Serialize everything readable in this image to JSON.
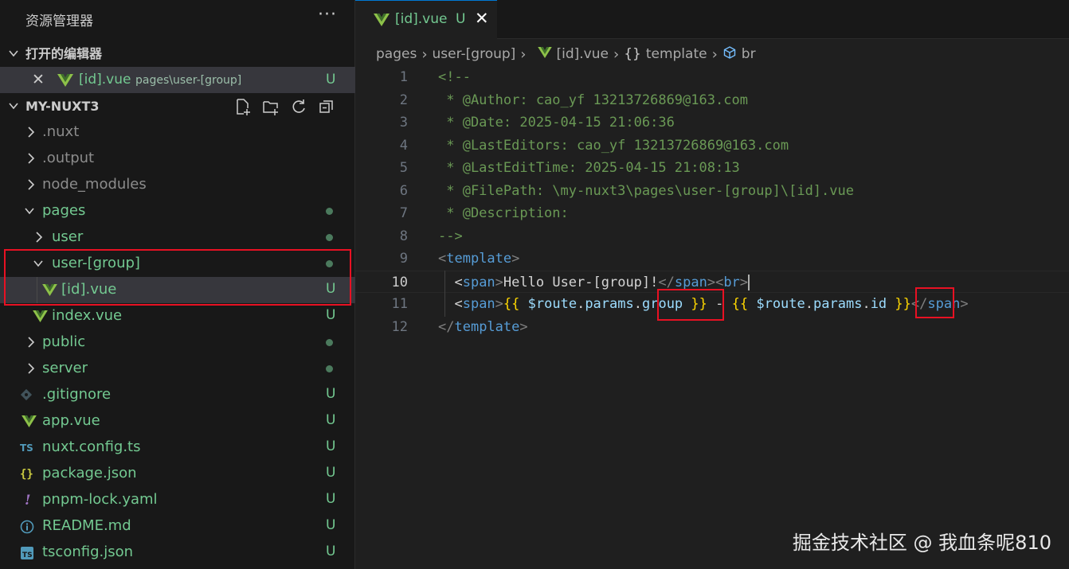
{
  "sidebar": {
    "title": "资源管理器",
    "more_icon": "···",
    "open_editors": {
      "label": "打开的编辑器",
      "item": {
        "close": "✕",
        "file": "[id].vue",
        "path": "pages\\user-[group]",
        "status": "U"
      }
    },
    "project": {
      "label": "MY-NUXT3"
    },
    "tree": [
      {
        "name": ".nuxt",
        "status": ""
      },
      {
        "name": ".output",
        "status": ""
      },
      {
        "name": "node_modules",
        "status": ""
      },
      {
        "name": "pages",
        "status": ""
      },
      {
        "name": "user",
        "status": ""
      },
      {
        "name": "user-[group]",
        "status": ""
      },
      {
        "name": "[id].vue",
        "status": "U"
      },
      {
        "name": "index.vue",
        "status": "U"
      },
      {
        "name": "public",
        "status": ""
      },
      {
        "name": "server",
        "status": ""
      },
      {
        "name": ".gitignore",
        "status": "U"
      },
      {
        "name": "app.vue",
        "status": "U"
      },
      {
        "name": "nuxt.config.ts",
        "status": "U"
      },
      {
        "name": "package.json",
        "status": "U"
      },
      {
        "name": "pnpm-lock.yaml",
        "status": "U"
      },
      {
        "name": "README.md",
        "status": "U"
      },
      {
        "name": "tsconfig.json",
        "status": "U"
      }
    ]
  },
  "editor": {
    "tab": {
      "name": "[id].vue",
      "status": "U",
      "close": "✕"
    },
    "breadcrumb": [
      "pages",
      "user-[group]",
      "[id].vue",
      "template",
      "br"
    ],
    "breadcrumb_braces": "{}",
    "lines": [
      {
        "n": "1",
        "t": [
          "<!--"
        ]
      },
      {
        "n": "2",
        "t": [
          " * @Author: cao_yf 13213726869@163.com"
        ]
      },
      {
        "n": "3",
        "t": [
          " * @Date: 2025-04-15 21:06:36"
        ]
      },
      {
        "n": "4",
        "t": [
          " * @LastEditors: cao_yf 13213726869@163.com"
        ]
      },
      {
        "n": "5",
        "t": [
          " * @LastEditTime: 2025-04-15 21:08:13"
        ]
      },
      {
        "n": "6",
        "t": [
          " * @FilePath: \\my-nuxt3\\pages\\user-[group]\\[id].vue"
        ]
      },
      {
        "n": "7",
        "t": [
          " * @Description: "
        ]
      },
      {
        "n": "8",
        "t": [
          "-->"
        ]
      },
      {
        "n": "9",
        "t": [
          "<",
          "template",
          ">"
        ]
      },
      {
        "n": "10",
        "t": [
          "  <",
          "span",
          ">",
          "Hello User-[group]!",
          "</",
          "span",
          "><",
          "br",
          ">"
        ]
      },
      {
        "n": "11",
        "t": [
          "  <",
          "span",
          ">",
          "{{",
          " $route",
          ".",
          "params",
          ".",
          "group",
          " ",
          "}}",
          " - ",
          "{{",
          " $route",
          ".",
          "params",
          ".",
          "id",
          " ",
          "}}",
          "</",
          "span",
          ">"
        ]
      },
      {
        "n": "12",
        "t": [
          "</",
          "template",
          ">"
        ]
      }
    ]
  },
  "watermark": "掘金技术社区 @ 我血条呢810",
  "colors": {
    "accent": "#0078d4",
    "untracked": "#73c991",
    "highlight_box": "#e81123"
  }
}
